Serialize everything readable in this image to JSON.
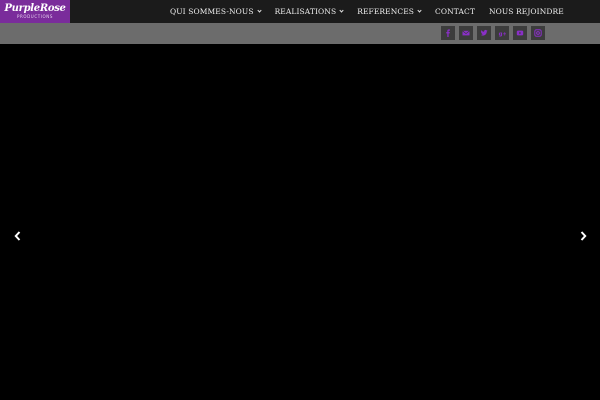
{
  "logo": {
    "text": "PurpleRose",
    "subtext": "PRODUCTIONS"
  },
  "nav": {
    "items": [
      {
        "label": "QUI SOMMES-NOUS",
        "has_dropdown": true
      },
      {
        "label": "REALISATIONS",
        "has_dropdown": true
      },
      {
        "label": "REFERENCES",
        "has_dropdown": true
      },
      {
        "label": "CONTACT",
        "has_dropdown": false
      },
      {
        "label": "NOUS REJOINDRE",
        "has_dropdown": false
      }
    ]
  },
  "social": {
    "icons": [
      "facebook-icon",
      "email-icon",
      "twitter-icon",
      "google-plus-icon",
      "youtube-icon",
      "instagram-icon"
    ],
    "icon_color": "#8a2fc8",
    "button_color": "#3c3c3c"
  },
  "colors": {
    "topbar": "#1b1b1b",
    "logo_bg": "#7a2c9b",
    "subbar": "#6c6c6c",
    "slider_bg": "#000000"
  },
  "slider": {
    "prev_icon": "chevron-left-icon",
    "next_icon": "chevron-right-icon"
  }
}
